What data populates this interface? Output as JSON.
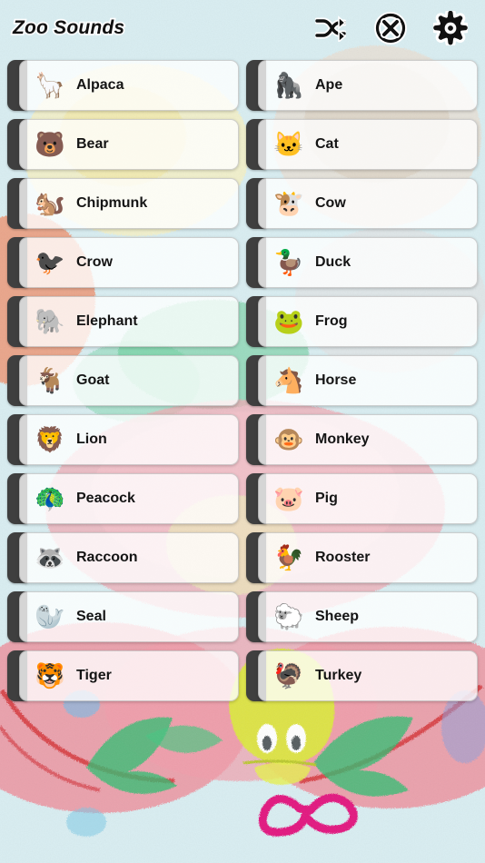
{
  "header": {
    "title": "Zoo Sounds",
    "actions": [
      {
        "name": "shuffle-icon",
        "label": "Shuffle"
      },
      {
        "name": "stop-icon",
        "label": "Stop"
      },
      {
        "name": "gear-icon",
        "label": "Settings"
      }
    ]
  },
  "theme": {
    "background": "#d9eef2",
    "handle": "#3f3f3f",
    "card": "#ffffff",
    "text": "#141414"
  },
  "list": {
    "items": [
      {
        "label": "Alpaca",
        "emoji": "🦙"
      },
      {
        "label": "Ape",
        "emoji": "🦍"
      },
      {
        "label": "Bear",
        "emoji": "🐻"
      },
      {
        "label": "Cat",
        "emoji": "🐱"
      },
      {
        "label": "Chipmunk",
        "emoji": "🐿️"
      },
      {
        "label": "Cow",
        "emoji": "🐮"
      },
      {
        "label": "Crow",
        "emoji": "🐦‍⬛"
      },
      {
        "label": "Duck",
        "emoji": "🦆"
      },
      {
        "label": "Elephant",
        "emoji": "🐘"
      },
      {
        "label": "Frog",
        "emoji": "🐸"
      },
      {
        "label": "Goat",
        "emoji": "🐐"
      },
      {
        "label": "Horse",
        "emoji": "🐴"
      },
      {
        "label": "Lion",
        "emoji": "🦁"
      },
      {
        "label": "Monkey",
        "emoji": "🐵"
      },
      {
        "label": "Peacock",
        "emoji": "🦚"
      },
      {
        "label": "Pig",
        "emoji": "🐷"
      },
      {
        "label": "Raccoon",
        "emoji": "🦝"
      },
      {
        "label": "Rooster",
        "emoji": "🐓"
      },
      {
        "label": "Seal",
        "emoji": "🦭"
      },
      {
        "label": "Sheep",
        "emoji": "🐑"
      },
      {
        "label": "Tiger",
        "emoji": "🐯"
      },
      {
        "label": "Turkey",
        "emoji": "🦃"
      }
    ]
  }
}
